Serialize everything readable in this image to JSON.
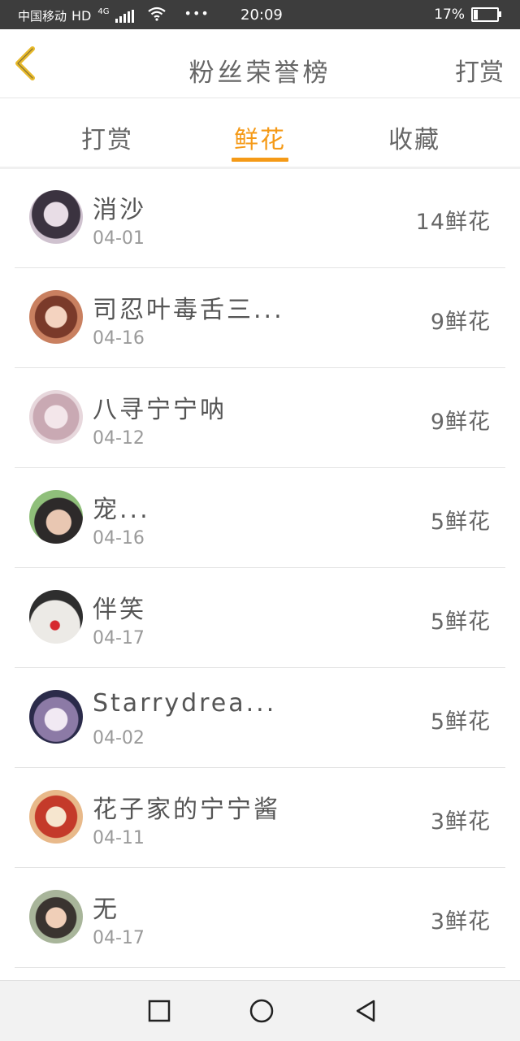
{
  "status_bar": {
    "carrier": "中国移动",
    "network_hd": "HD",
    "network_type": "4G",
    "more": "•••",
    "time": "20:09",
    "battery_percent": "17%",
    "battery_level": 0.17
  },
  "header": {
    "title": "粉丝荣誉榜",
    "action_label": "打赏",
    "accent_color": "#f59a17"
  },
  "tabs": [
    {
      "label": "打赏",
      "active": false
    },
    {
      "label": "鲜花",
      "active": true
    },
    {
      "label": "收藏",
      "active": false
    }
  ],
  "fans": [
    {
      "name": "消沙",
      "date": "04-01",
      "count": "14鲜花",
      "avatar": "avatar-dark-hair"
    },
    {
      "name": "司忍叶毒舌三...",
      "date": "04-16",
      "count": "9鲜花",
      "avatar": "avatar-anime-girl"
    },
    {
      "name": "八寻宁宁呐",
      "date": "04-12",
      "count": "9鲜花",
      "avatar": "avatar-pastel-anime"
    },
    {
      "name": "宠...",
      "date": "04-16",
      "count": "5鲜花",
      "avatar": "avatar-boy-photo"
    },
    {
      "name": "伴笑",
      "date": "04-17",
      "count": "5鲜花",
      "avatar": "avatar-clown"
    },
    {
      "name": "Starrydrea...",
      "date": "04-02",
      "count": "5鲜花",
      "avatar": "avatar-night-sky"
    },
    {
      "name": "花子家的宁宁酱",
      "date": "04-11",
      "count": "3鲜花",
      "avatar": "avatar-red-anime"
    },
    {
      "name": "无",
      "date": "04-17",
      "count": "3鲜花",
      "avatar": "avatar-girl-photo"
    }
  ]
}
